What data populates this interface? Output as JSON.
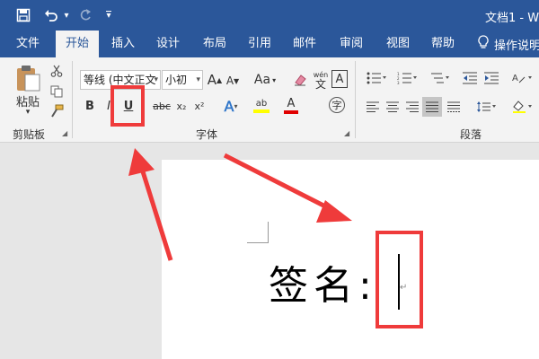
{
  "titlebar": {
    "save_icon": "save-icon",
    "undo_icon": "undo-icon",
    "undo_arrow": "▾",
    "redo_icon": "redo-icon",
    "customize_icon": "▾",
    "document_title": "文档1 - W"
  },
  "tabs": [
    {
      "label": "文件",
      "active": false
    },
    {
      "label": "开始",
      "active": true
    },
    {
      "label": "插入",
      "active": false
    },
    {
      "label": "设计",
      "active": false
    },
    {
      "label": "布局",
      "active": false
    },
    {
      "label": "引用",
      "active": false
    },
    {
      "label": "邮件",
      "active": false
    },
    {
      "label": "审阅",
      "active": false
    },
    {
      "label": "视图",
      "active": false
    },
    {
      "label": "帮助",
      "active": false
    }
  ],
  "tell_me": {
    "label": "操作说明",
    "icon": "lightbulb-icon"
  },
  "clipboard": {
    "group_label": "剪贴板",
    "paste_label": "粘贴",
    "paste_arrow": "▾",
    "cut_icon": "cut-icon",
    "copy_icon": "copy-icon",
    "format_painter_icon": "format-painter-icon"
  },
  "font": {
    "group_label": "字体",
    "font_name": "等线 (中文正文",
    "font_size": "小初",
    "grow_label": "A",
    "shrink_label": "A",
    "change_case_label": "Aa",
    "clear_format_icon": "eraser-icon",
    "phonetic_top": "wén",
    "phonetic_bottom": "文",
    "char_border_label": "A",
    "bold_label": "B",
    "italic_label": "I",
    "underline_label": "U",
    "strike_label": "abc",
    "subscript_label": "x₂",
    "superscript_label": "x²",
    "text_effect_label": "A",
    "highlight_label": "ab",
    "font_color_label": "A",
    "enclose_label": "字"
  },
  "paragraph": {
    "group_label": "段落"
  },
  "document": {
    "signature_text": "签名:",
    "paragraph_mark": "↵"
  },
  "colors": {
    "brand": "#2b579a",
    "annotation": "#ef3b3b",
    "highlight_yellow": "#ffff00",
    "font_red": "#e00000"
  }
}
